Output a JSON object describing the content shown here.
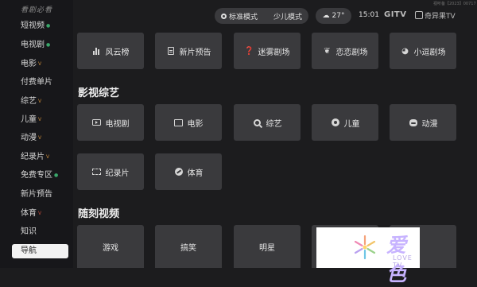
{
  "sidebar": {
    "brand": "看剧必看",
    "items": [
      {
        "label": "短视频",
        "mark": "●",
        "mark_color": "green"
      },
      {
        "label": "电视剧",
        "mark": "●",
        "mark_color": "green"
      },
      {
        "label": "电影",
        "mark": "V",
        "mark_color": "orange"
      },
      {
        "label": "付费单片",
        "mark": "",
        "mark_color": ""
      },
      {
        "label": "综艺",
        "mark": "V",
        "mark_color": "orange"
      },
      {
        "label": "儿童",
        "mark": "V",
        "mark_color": "orange"
      },
      {
        "label": "动漫",
        "mark": "V",
        "mark_color": "orange"
      },
      {
        "label": "纪录片",
        "mark": "V",
        "mark_color": "orange"
      },
      {
        "label": "免费专区",
        "mark": "●",
        "mark_color": "green"
      },
      {
        "label": "新片预告",
        "mark": "",
        "mark_color": ""
      },
      {
        "label": "体育",
        "mark": "V",
        "mark_color": "red"
      },
      {
        "label": "知识",
        "mark": "",
        "mark_color": ""
      }
    ],
    "active_label": "导航"
  },
  "topbar": {
    "mode_standard": "标准模式",
    "mode_kids": "少儿模式",
    "weather_temp": "27°",
    "time": "15:01",
    "brand_left": "GITV",
    "brand_right": "奇异果TV",
    "tiny_note": "视听备【2023】00717"
  },
  "row1": [
    {
      "label": "风云榜",
      "icon": "chart-icon"
    },
    {
      "label": "新片预告",
      "icon": "document-icon"
    },
    {
      "label": "迷雾剧场",
      "icon": "mist-icon"
    },
    {
      "label": "恋恋剧场",
      "icon": "leaf-icon"
    },
    {
      "label": "小逗剧场",
      "icon": "swirl-icon"
    }
  ],
  "section_variety": "影视综艺",
  "row2": [
    {
      "label": "电视剧",
      "icon": "tv-icon"
    },
    {
      "label": "电影",
      "icon": "film-icon"
    },
    {
      "label": "综艺",
      "icon": "search-icon"
    },
    {
      "label": "儿童",
      "icon": "kid-icon"
    },
    {
      "label": "动漫",
      "icon": "bear-icon"
    }
  ],
  "row3": [
    {
      "label": "纪录片",
      "icon": "reel-icon"
    },
    {
      "label": "体育",
      "icon": "ball-icon"
    }
  ],
  "section_random": "随刻视频",
  "row4": [
    {
      "label": "游戏"
    },
    {
      "label": "搞笑"
    },
    {
      "label": "明星"
    }
  ],
  "logo": {
    "text": "爱色",
    "sub": "LOVE TV",
    "color": "#c7b3ff"
  }
}
